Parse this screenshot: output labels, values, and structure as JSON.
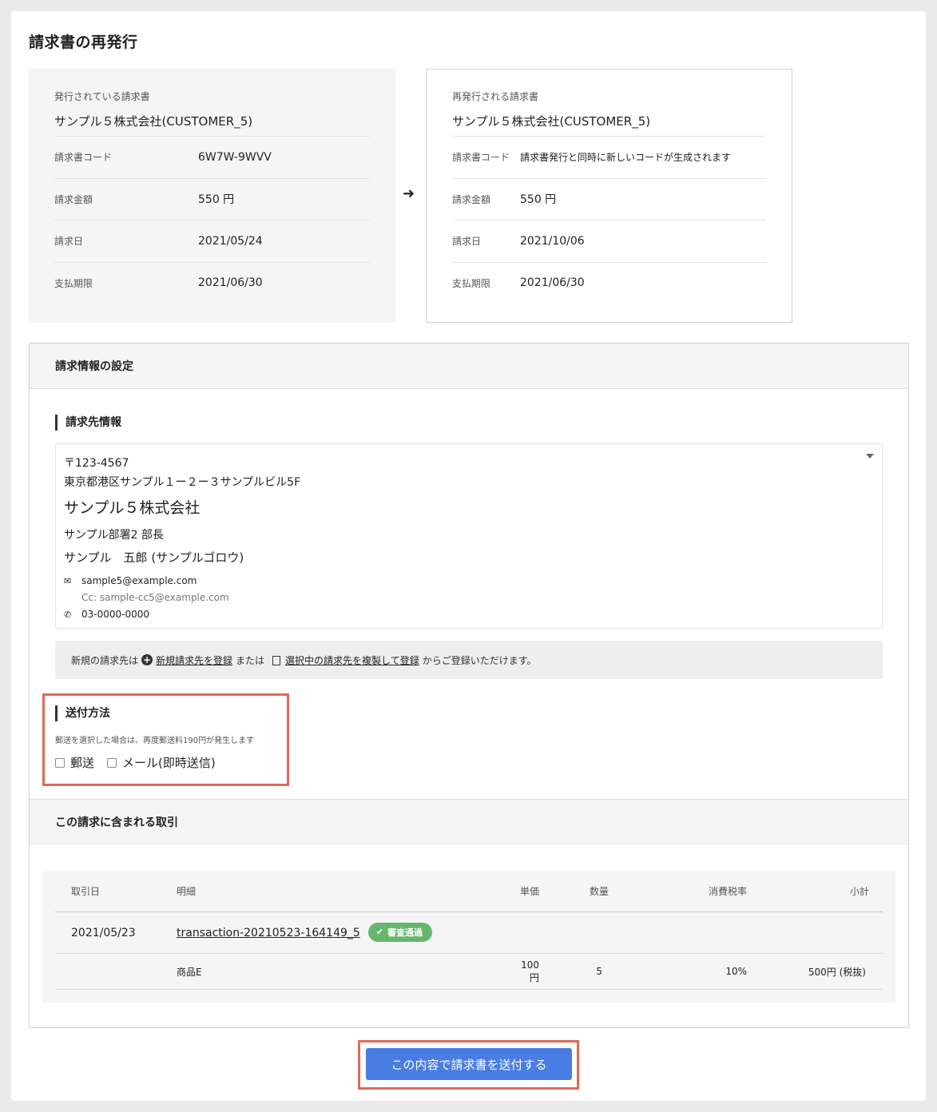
{
  "page": {
    "title": "請求書の再発行"
  },
  "original_invoice": {
    "label": "発行されている請求書",
    "customer": "サンプル５株式会社(CUSTOMER_5)",
    "rows": [
      {
        "key": "請求書コード",
        "value": "6W7W-9WVV"
      },
      {
        "key": "請求金額",
        "value": "550 円"
      },
      {
        "key": "請求日",
        "value": "2021/05/24"
      },
      {
        "key": "支払期限",
        "value": "2021/06/30"
      }
    ]
  },
  "arrow_icon": "arrow-right",
  "reissued_invoice": {
    "label": "再発行される請求書",
    "customer": "サンプル５株式会社(CUSTOMER_5)",
    "rows": [
      {
        "key": "請求書コード",
        "value": "請求書発行と同時に新しいコードが生成されます"
      },
      {
        "key": "請求金額",
        "value": "550 円"
      },
      {
        "key": "請求日",
        "value": "2021/10/06"
      },
      {
        "key": "支払期限",
        "value": "2021/06/30"
      }
    ]
  },
  "billing_settings": {
    "title": "請求情報の設定",
    "recipient_section": "請求先情報",
    "recipient": {
      "zip": "〒123-4567",
      "address": "東京都港区サンプル１ー２ー３サンプルビル5F",
      "company": "サンプル５株式会社",
      "department": "サンプル部署2 部長",
      "person": "サンプル　五郎 (サンプルゴロウ)",
      "email": "sample5@example.com",
      "cc": "Cc: sample-cc5@example.com",
      "phone": "03-0000-0000"
    },
    "notice": {
      "prefix": "新規の請求先は",
      "link1": "新規請求先を登録",
      "middle": "または",
      "link2": "選択中の請求先を複製して登録",
      "suffix": "からご登録いただけます。"
    },
    "shipping_section": "送付方法",
    "shipping_note": "郵送を選択した場合は、再度郵送料190円が発生します",
    "shipping_options": [
      "郵送",
      "メール(即時送信)"
    ]
  },
  "transactions": {
    "title": "この請求に含まれる取引",
    "headers": [
      "取引日",
      "明細",
      "単価",
      "数量",
      "消費税率",
      "小計"
    ],
    "row": {
      "date": "2021/05/23",
      "id": "transaction-20210523-164149_5",
      "badge": "審査通過"
    },
    "item": {
      "name": "商品E",
      "unit_price": "100円",
      "quantity": "5",
      "tax_rate": "10%",
      "subtotal": "500円 (税抜)"
    }
  },
  "submit_button": "この内容で請求書を送付する",
  "colors": {
    "primary": "#4a7de3",
    "badge": "#67b66d",
    "highlight": "#dc6b58"
  }
}
